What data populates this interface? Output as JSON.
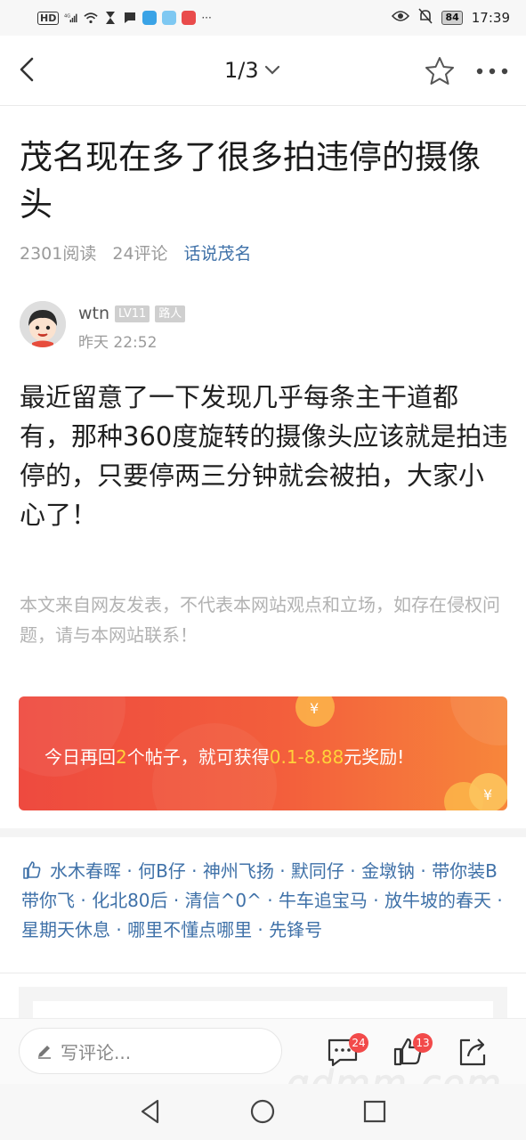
{
  "status_bar": {
    "network": "HD",
    "signal": "4G",
    "battery": "84",
    "time": "17:39",
    "more": "···"
  },
  "nav": {
    "page_indicator": "1/3"
  },
  "post": {
    "title": "茂名现在多了很多拍违停的摄像头",
    "reads": "2301阅读",
    "comments": "24评论",
    "board": "话说茂名",
    "author": {
      "name": "wtn",
      "level": "LV11",
      "rank": "路人",
      "time": "昨天 22:52"
    },
    "content": "最近留意了一下发现几乎每条主干道都有，那种360度旋转的摄像头应该就是拍违停的，只要停两三分钟就会被拍，大家小心了！",
    "disclaimer": "本文来自网友发表，不代表本网站观点和立场，如存在侵权问题，请与本网站联系！"
  },
  "banner": {
    "text_prefix": "今日再回",
    "count": "2",
    "text_mid": "个帖子，就可获得",
    "amount": "0.1-8.88",
    "text_suffix": "元奖励!"
  },
  "likes": {
    "users_text": "水木春晖 · 何B仔 · 神州飞扬 · 默同仔 · 金墩钠 · 带你装B带你飞 · 化北80后 · 清信^0^ · 牛车追宝马 · 放牛坡的春天 · 星期天休息 · 哪里不懂点哪里 · 先锋号"
  },
  "bottom_bar": {
    "comment_placeholder": "写评论...",
    "comment_count": "24",
    "like_count": "13"
  },
  "watermark": "gdmm.com",
  "colors": {
    "link_blue": "#3f71a8",
    "banner_red": "#ee4a3f",
    "banner_orange": "#f7863b",
    "highlight_yellow": "#ffd23a",
    "badge_red": "#f24a4a"
  }
}
